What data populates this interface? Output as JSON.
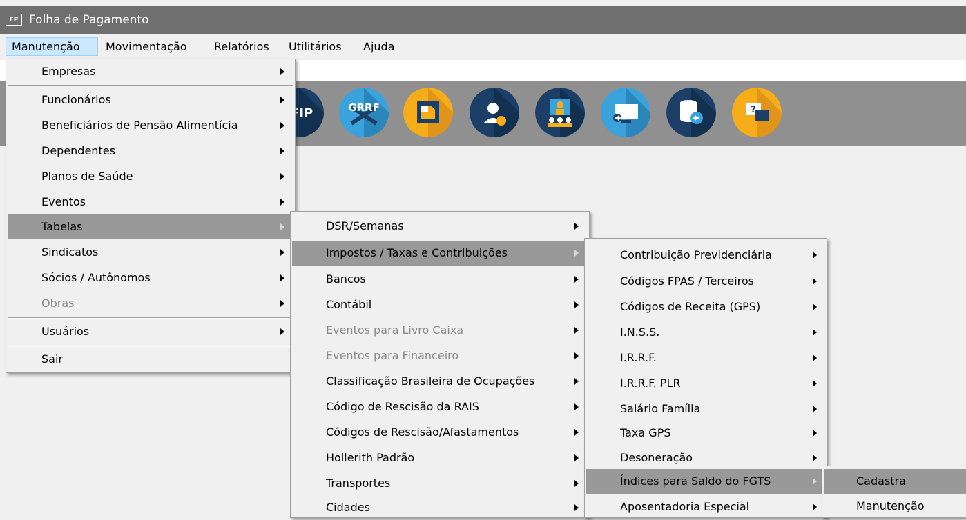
{
  "window": {
    "app_icon_text": "FP",
    "title": "Folha de Pagamento"
  },
  "menubar": {
    "items": [
      {
        "label": "Manutenção"
      },
      {
        "label": "Movimentação"
      },
      {
        "label": "Relatórios"
      },
      {
        "label": "Utilitários"
      },
      {
        "label": "Ajuda"
      }
    ]
  },
  "toolbar": {
    "buttons": [
      {
        "name": "sefip-icon",
        "text": "EFIP",
        "color": "#1c3f68"
      },
      {
        "name": "grrf-icon",
        "text": "GRRF",
        "color": "#3aa3dc"
      },
      {
        "name": "document-icon",
        "color": "#f6ad1a"
      },
      {
        "name": "support-agent-icon",
        "color": "#1c3f68"
      },
      {
        "name": "meeting-icon",
        "color": "#1c3f68"
      },
      {
        "name": "remote-access-icon",
        "color": "#3aa3dc"
      },
      {
        "name": "database-restore-icon",
        "color": "#1c3f68"
      },
      {
        "name": "help-chat-icon",
        "color": "#f6ad1a"
      }
    ]
  },
  "menu_manutencao": {
    "items": [
      {
        "label": "Empresas"
      },
      {
        "label": "Funcionários"
      },
      {
        "label": "Beneficiários de Pensão Alimentícia"
      },
      {
        "label": "Dependentes"
      },
      {
        "label": "Planos de Saúde"
      },
      {
        "label": "Eventos"
      },
      {
        "label": "Tabelas"
      },
      {
        "label": "Sindicatos"
      },
      {
        "label": "Sócios / Autônomos"
      },
      {
        "label": "Obras"
      },
      {
        "label": "Usuários"
      },
      {
        "label": "Sair"
      }
    ]
  },
  "menu_tabelas": {
    "items": [
      {
        "label": "DSR/Semanas"
      },
      {
        "label": "Impostos / Taxas e Contribuições"
      },
      {
        "label": "Bancos"
      },
      {
        "label": "Contábil"
      },
      {
        "label": "Eventos para Livro Caixa"
      },
      {
        "label": "Eventos para Financeiro"
      },
      {
        "label": "Classificação Brasileira de Ocupações"
      },
      {
        "label": "Código de Rescisão da RAIS"
      },
      {
        "label": "Códigos de Rescisão/Afastamentos"
      },
      {
        "label": "Hollerith Padrão"
      },
      {
        "label": "Transportes"
      },
      {
        "label": "Cidades"
      }
    ]
  },
  "menu_impostos": {
    "items": [
      {
        "label": "Contribuição Previdenciária"
      },
      {
        "label": "Códigos FPAS / Terceiros"
      },
      {
        "label": "Códigos de Receita (GPS)"
      },
      {
        "label": "I.N.S.S."
      },
      {
        "label": "I.R.R.F."
      },
      {
        "label": "I.R.R.F. PLR"
      },
      {
        "label": "Salário Família"
      },
      {
        "label": "Taxa GPS"
      },
      {
        "label": "Desoneração"
      },
      {
        "label": "Índices para Saldo do FGTS"
      },
      {
        "label": "Aposentadoria Especial"
      }
    ]
  },
  "menu_fgts": {
    "items": [
      {
        "label": "Cadastra"
      },
      {
        "label": "Manutenção"
      }
    ]
  }
}
